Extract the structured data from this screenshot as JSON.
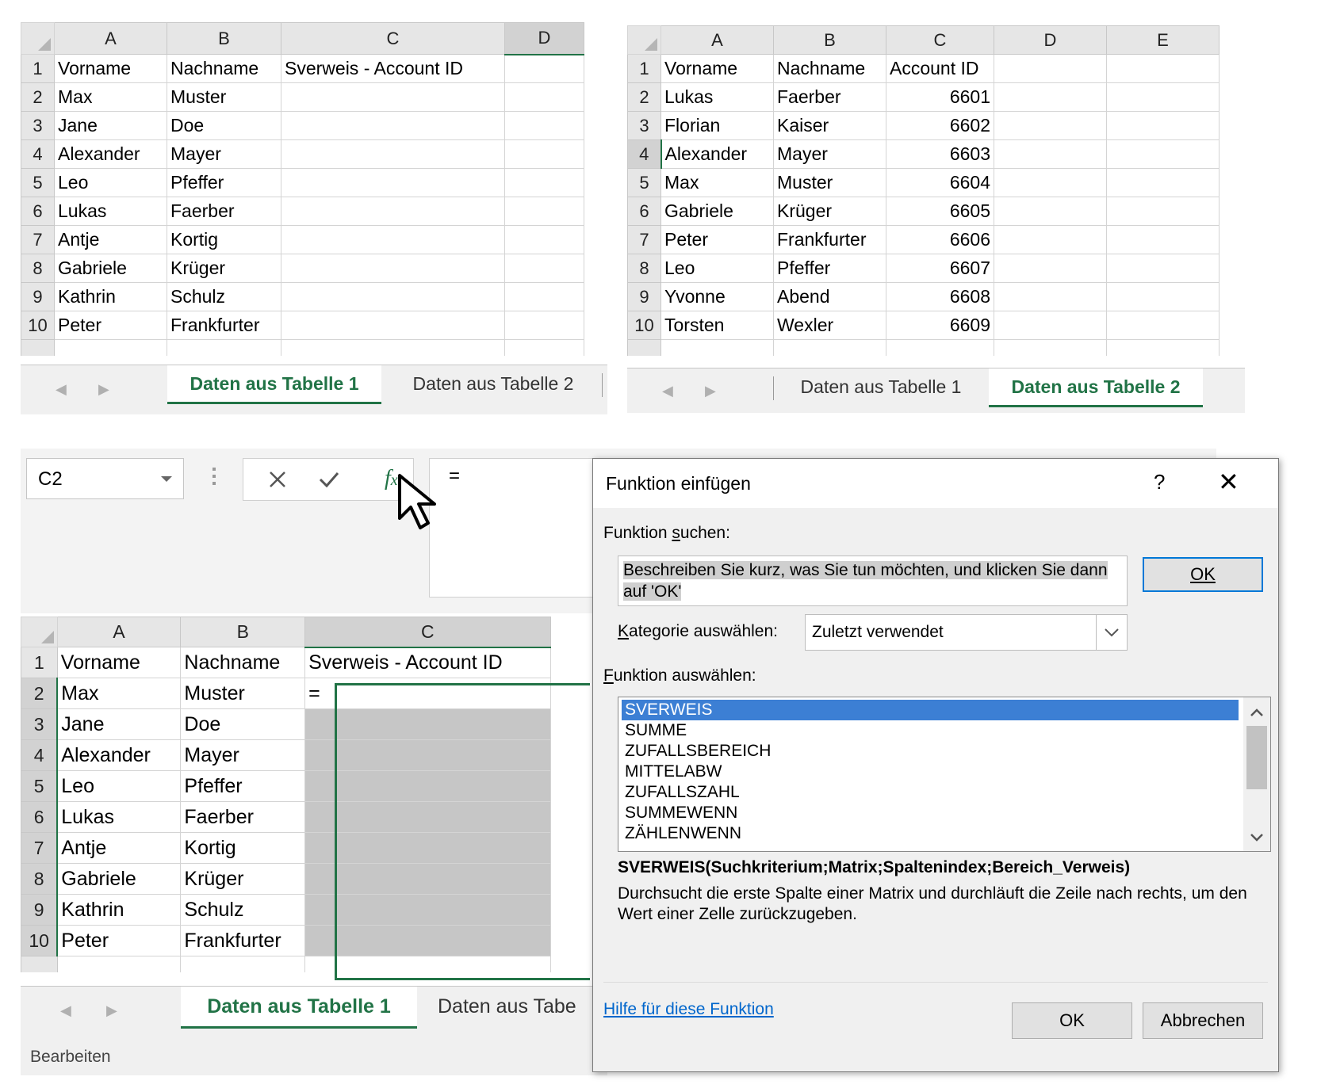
{
  "sheet1": {
    "columns": [
      "A",
      "B",
      "C",
      "D"
    ],
    "rows": [
      {
        "n": "1",
        "a": "Vorname",
        "b": "Nachname",
        "c": "Sverweis - Account ID"
      },
      {
        "n": "2",
        "a": "Max",
        "b": "Muster",
        "c": ""
      },
      {
        "n": "3",
        "a": "Jane",
        "b": "Doe",
        "c": ""
      },
      {
        "n": "4",
        "a": "Alexander",
        "b": "Mayer",
        "c": ""
      },
      {
        "n": "5",
        "a": "Leo",
        "b": "Pfeffer",
        "c": ""
      },
      {
        "n": "6",
        "a": "Lukas",
        "b": "Faerber",
        "c": ""
      },
      {
        "n": "7",
        "a": "Antje",
        "b": "Kortig",
        "c": ""
      },
      {
        "n": "8",
        "a": "Gabriele",
        "b": "Krüger",
        "c": ""
      },
      {
        "n": "9",
        "a": "Kathrin",
        "b": "Schulz",
        "c": ""
      },
      {
        "n": "10",
        "a": "Peter",
        "b": "Frankfurter",
        "c": ""
      }
    ],
    "tabs": [
      "Daten aus Tabelle 1",
      "Daten aus Tabelle 2"
    ]
  },
  "sheet2": {
    "columns": [
      "A",
      "B",
      "C",
      "D",
      "E"
    ],
    "rows": [
      {
        "n": "1",
        "a": "Vorname",
        "b": "Nachname",
        "c": "Account ID"
      },
      {
        "n": "2",
        "a": "Lukas",
        "b": "Faerber",
        "c": "6601"
      },
      {
        "n": "3",
        "a": "Florian",
        "b": "Kaiser",
        "c": "6602"
      },
      {
        "n": "4",
        "a": "Alexander",
        "b": "Mayer",
        "c": "6603"
      },
      {
        "n": "5",
        "a": "Max",
        "b": "Muster",
        "c": "6604"
      },
      {
        "n": "6",
        "a": "Gabriele",
        "b": "Krüger",
        "c": "6605"
      },
      {
        "n": "7",
        "a": "Peter",
        "b": "Frankfurter",
        "c": "6606"
      },
      {
        "n": "8",
        "a": "Leo",
        "b": "Pfeffer",
        "c": "6607"
      },
      {
        "n": "9",
        "a": "Yvonne",
        "b": "Abend",
        "c": "6608"
      },
      {
        "n": "10",
        "a": "Torsten",
        "b": "Wexler",
        "c": "6609"
      }
    ],
    "tabs": [
      "Daten aus Tabelle 1",
      "Daten aus Tabelle 2"
    ]
  },
  "sheet3": {
    "columns": [
      "A",
      "B",
      "C"
    ],
    "rows": [
      {
        "n": "1",
        "a": "Vorname",
        "b": "Nachname",
        "c": "Sverweis - Account ID"
      },
      {
        "n": "2",
        "a": "Max",
        "b": "Muster",
        "c": "="
      },
      {
        "n": "3",
        "a": "Jane",
        "b": "Doe",
        "c": ""
      },
      {
        "n": "4",
        "a": "Alexander",
        "b": "Mayer",
        "c": ""
      },
      {
        "n": "5",
        "a": "Leo",
        "b": "Pfeffer",
        "c": ""
      },
      {
        "n": "6",
        "a": "Lukas",
        "b": "Faerber",
        "c": ""
      },
      {
        "n": "7",
        "a": "Antje",
        "b": "Kortig",
        "c": ""
      },
      {
        "n": "8",
        "a": "Gabriele",
        "b": "Krüger",
        "c": ""
      },
      {
        "n": "9",
        "a": "Kathrin",
        "b": "Schulz",
        "c": ""
      },
      {
        "n": "10",
        "a": "Peter",
        "b": "Frankfurter",
        "c": ""
      }
    ],
    "tabs": [
      "Daten aus Tabelle 1",
      "Daten aus Tabe"
    ],
    "status": "Bearbeiten"
  },
  "formula_bar": {
    "name_box": "C2",
    "formula": "=",
    "cancel_icon": "x-icon",
    "enter_icon": "check-icon",
    "fx_icon": "fx-icon"
  },
  "dialog": {
    "title": "Funktion einfügen",
    "help": "?",
    "search_label": "Funktion suchen:",
    "search_text": "Beschreiben Sie kurz, was Sie tun möchten, und klicken Sie dann auf 'OK'",
    "search_ok": "OK",
    "category_label": "Kategorie auswählen:",
    "category_value": "Zuletzt verwendet",
    "function_label": "Funktion auswählen:",
    "functions": [
      "SVERWEIS",
      "SUMME",
      "ZUFALLSBEREICH",
      "MITTELABW",
      "ZUFALLSZAHL",
      "SUMMEWENN",
      "ZÄHLENWENN"
    ],
    "selected_function": "SVERWEIS",
    "syntax": "SVERWEIS(Suchkriterium;Matrix;Spaltenindex;Bereich_Verweis)",
    "description": "Durchsucht die erste Spalte einer Matrix und durchläuft die Zeile nach rechts, um den Wert einer Zelle zurückzugeben.",
    "help_link": "Hilfe für diese Funktion",
    "ok": "OK",
    "cancel": "Abbrechen"
  },
  "colors": {
    "excel_green": "#217346",
    "selection_blue": "#3c7fd4",
    "link_blue": "#0066cc"
  }
}
